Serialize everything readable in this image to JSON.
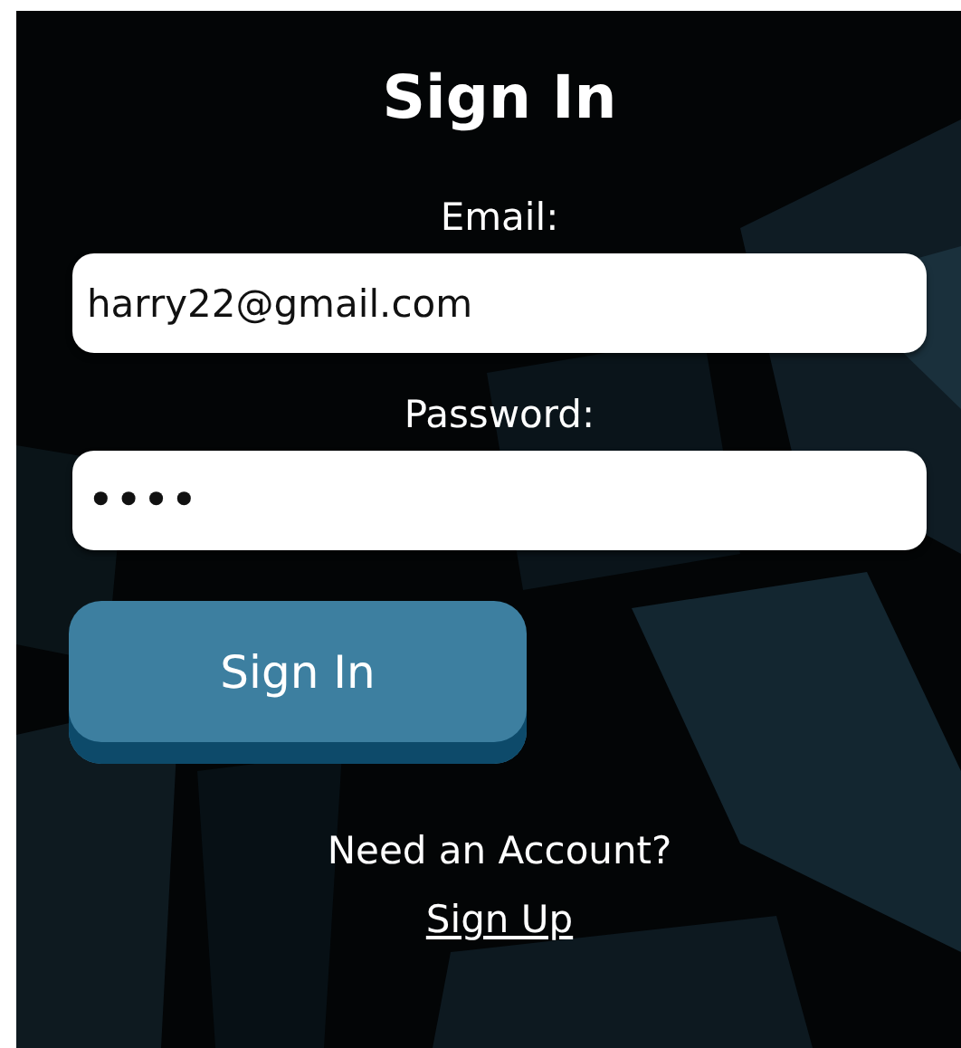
{
  "title": "Sign In",
  "fields": [
    {
      "label": "Email:",
      "value": "harry22@gmail.com",
      "kind": "text"
    },
    {
      "label": "Password:",
      "value": "••••",
      "kind": "password"
    }
  ],
  "submit": "Sign In",
  "prompt": "Need an Account?",
  "link": "Sign Up"
}
